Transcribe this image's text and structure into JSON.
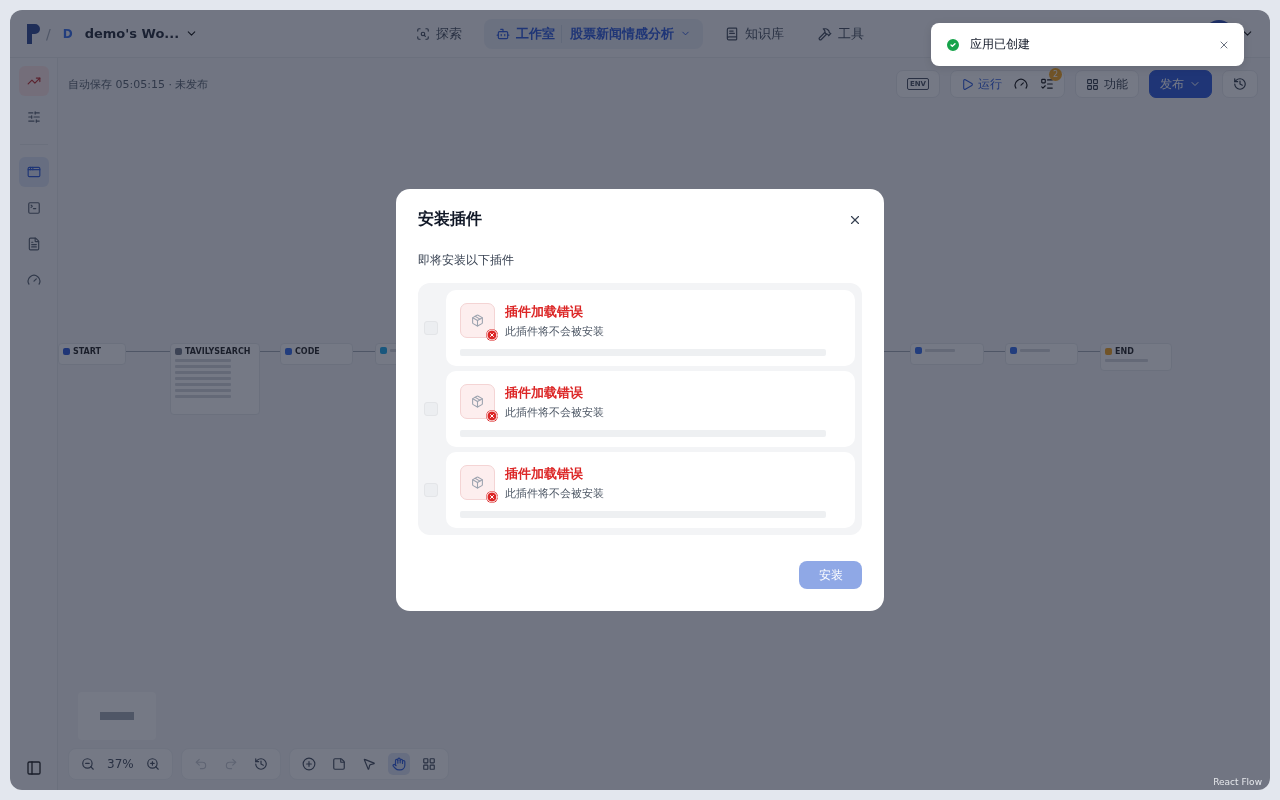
{
  "topbar": {
    "workspace_initial": "D",
    "workspace_name": "demo's Wo...",
    "separator": "/",
    "nav": [
      {
        "label": "探索",
        "selected": false
      },
      {
        "label": "工作室",
        "selected": true,
        "app_name": "股票新闻情感分析"
      },
      {
        "label": "知识库",
        "selected": false
      },
      {
        "label": "工具",
        "selected": false
      }
    ]
  },
  "sidebar": {
    "items": [
      {
        "selected": true
      },
      {
        "selected": false
      },
      {
        "selected": true
      },
      {
        "selected": false
      },
      {
        "selected": false
      },
      {
        "selected": false
      }
    ]
  },
  "status": "自动保存 05:05:15 · 未发布",
  "toolbar": {
    "env": "ENV",
    "run": "运行",
    "badge": "2",
    "features": "功能",
    "publish": "发布"
  },
  "canvas": {
    "nodes": [
      {
        "kind": "start",
        "title": "START"
      },
      {
        "kind": "tool",
        "title": "TAVILYSEARCH"
      },
      {
        "kind": "code",
        "title": "CODE"
      },
      {
        "kind": "plugin"
      },
      {
        "kind": "code"
      },
      {
        "kind": "code"
      },
      {
        "kind": "end",
        "title": "END"
      }
    ],
    "attribution": "React Flow"
  },
  "bottom_tools": {
    "zoom": "37%",
    "undo_disabled": true,
    "redo_disabled": true,
    "tools": [
      {
        "selected": false
      },
      {
        "selected": false
      },
      {
        "selected": false
      },
      {
        "selected": true
      },
      {
        "selected": false
      }
    ]
  },
  "toast": {
    "message": "应用已创建"
  },
  "dialog": {
    "title": "安装插件",
    "subtitle": "即将安装以下插件",
    "plugins": [
      {
        "title": "插件加载错误",
        "description": "此插件将不会被安装",
        "checked": false,
        "disabled": true
      },
      {
        "title": "插件加载错误",
        "description": "此插件将不会被安装",
        "checked": false,
        "disabled": true
      },
      {
        "title": "插件加载错误",
        "description": "此插件将不会被安装",
        "checked": false,
        "disabled": true
      }
    ],
    "install": {
      "label": "安装",
      "disabled": true
    }
  }
}
